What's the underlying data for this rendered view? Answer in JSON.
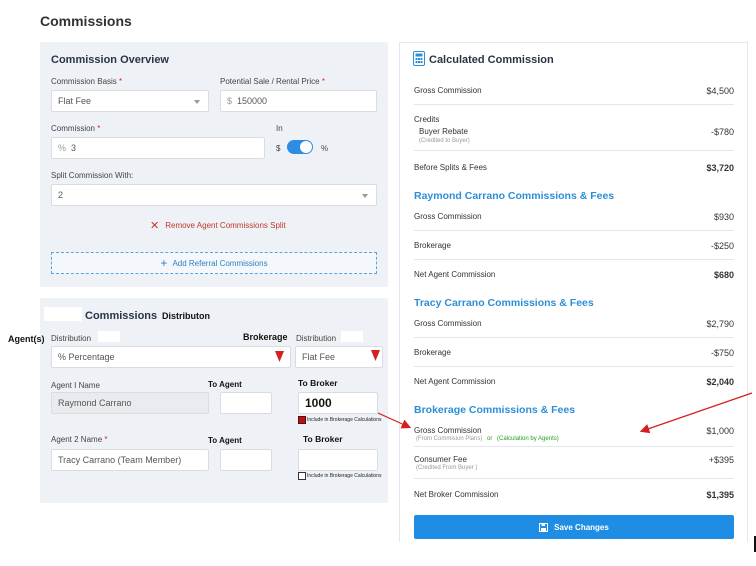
{
  "page": {
    "title": "Commissions"
  },
  "overview": {
    "title": "Commission Overview",
    "basis_label": "Commission Basis",
    "basis_value": "Flat Fee",
    "price_label": "Potential Sale / Rental Price",
    "price_prefix": "$",
    "price_value": "150000",
    "commission_label": "Commission",
    "commission_prefix": "%",
    "commission_value": "3",
    "in_label": "In",
    "dollar": "$",
    "percent": "%",
    "split_label": "Split Commission With:",
    "split_value": "2",
    "remove_link": "Remove Agent Commissions Split",
    "add_referral": "Add Referral Commissions",
    "required_mark": "*"
  },
  "distribution": {
    "title_a": "Commissions",
    "title_b": "Distributon",
    "agents_label": "Agent(s)",
    "distribution_label": "Distribution",
    "brokerage_label": "Brokerage",
    "agent_dist_value": "% Percentage",
    "broker_dist_value": "Flat Fee",
    "agent1_label": "Agent I Name",
    "agent1_value": "Raymond Carrano",
    "to_agent": "To Agent",
    "to_broker": "To Broker",
    "broker1_value": "1000",
    "include_note": "Include in Brokerage Calculations",
    "agent2_label": "Agent 2 Name",
    "agent2_value": "Tracy Carrano (Team Member)",
    "to_agent_2": "To Agent",
    "to_broker_2": "To Broker"
  },
  "calculated": {
    "title": "Calculated Commission",
    "gross_label": "Gross Commission",
    "gross_value": "$4,500",
    "credits_label": "Credits",
    "buyer_rebate_label": "Buyer Rebate",
    "buyer_rebate_note": "(Credited to Buyer)",
    "buyer_rebate_value": "-$780",
    "before_label": "Before Splits & Fees",
    "before_value": "$3,720",
    "raymond_title": "Raymond Carrano Commissions & Fees",
    "r_gross_label": "Gross Commission",
    "r_gross_value": "$930",
    "r_brokerage_label": "Brokerage",
    "r_brokerage_value": "-$250",
    "r_net_label": "Net Agent Commission",
    "r_net_value": "$680",
    "tracy_title": "Tracy Carrano Commissions & Fees",
    "t_gross_label": "Gross Commission",
    "t_gross_value": "$2,790",
    "t_brokerage_label": "Brokerage",
    "t_brokerage_value": "-$750",
    "t_net_label": "Net Agent Commission",
    "t_net_value": "$2,040",
    "brokerage_title": "Brokerage Commissions & Fees",
    "b_gross_label": "Gross Commission",
    "b_gross_note_a": "(From Commision Plans)",
    "b_gross_note_or": "or",
    "b_gross_note_b": "(Calculation by Agents)",
    "b_gross_value": "$1,000",
    "consumer_label": "Consumer Fee",
    "consumer_note": "(Credited From Buyer )",
    "consumer_value": "+$395",
    "net_broker_label": "Net Broker Commission",
    "net_broker_value": "$1,395",
    "save_label": "Save Changes"
  },
  "colors": {
    "accent": "#2b8fd6",
    "button": "#1f8de3",
    "annotation_red": "#d61f1f",
    "annotation_green": "#22a322"
  }
}
